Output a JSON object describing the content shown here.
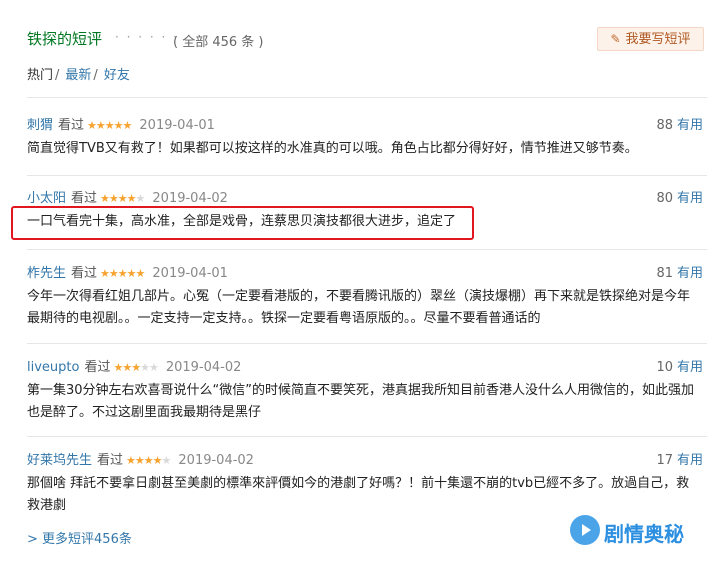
{
  "header": {
    "title": "铁探的短评",
    "dots": "· · · · · ·",
    "count": "( 全部 456 条 )",
    "write_button": "我要写短评"
  },
  "tabs": [
    {
      "label": "热门"
    },
    {
      "label": "最新"
    },
    {
      "label": "好友"
    }
  ],
  "tab_separator": "/",
  "watched_label": "看过",
  "useful_label": "有用",
  "colors": {
    "accent": "#3377aa",
    "title": "#007722",
    "star": "#f7a32f",
    "highlight": "#e2161f"
  },
  "comments": [
    {
      "user": "刺猬",
      "rating": 5,
      "date": "2019-04-01",
      "votes": "88",
      "text": "简直觉得TVB又有救了！如果都可以按这样的水准真的可以哦。角色占比都分得好好，情节推进又够节奏。"
    },
    {
      "user": "小太阳",
      "rating": 4,
      "date": "2019-04-02",
      "votes": "80",
      "text": "一口气看完十集，高水准，全部是戏骨，连蔡思贝演技都很大进步，追定了"
    },
    {
      "user": "柞先生",
      "rating": 5,
      "date": "2019-04-01",
      "votes": "81",
      "text": "今年一次得看红姐几部片。心冤（一定要看港版的，不要看腾讯版的）翠丝（演技爆棚）再下来就是铁探绝对是今年最期待的电视剧。。一定支持一定支持。。铁探一定要看粤语原版的。。尽量不要看普通话的"
    },
    {
      "user": "liveupto",
      "rating": 3,
      "date": "2019-04-02",
      "votes": "10",
      "text": "第一集30分钟左右欢喜哥说什么“微信”的时候简直不要笑死，港真据我所知目前香港人没什么人用微信的，如此强加也是醉了。不过这剧里面我最期待是黑仔"
    },
    {
      "user": "好莱坞先生",
      "rating": 4,
      "date": "2019-04-02",
      "votes": "17",
      "text": "那個啥 拜託不要拿日劇甚至美劇的標準來評價如今的港劇了好嗎？！前十集還不崩的tvb已經不多了。放過自己，救救港劇"
    }
  ],
  "more_link": "> 更多短评456条",
  "watermark": "剧情奥秘"
}
